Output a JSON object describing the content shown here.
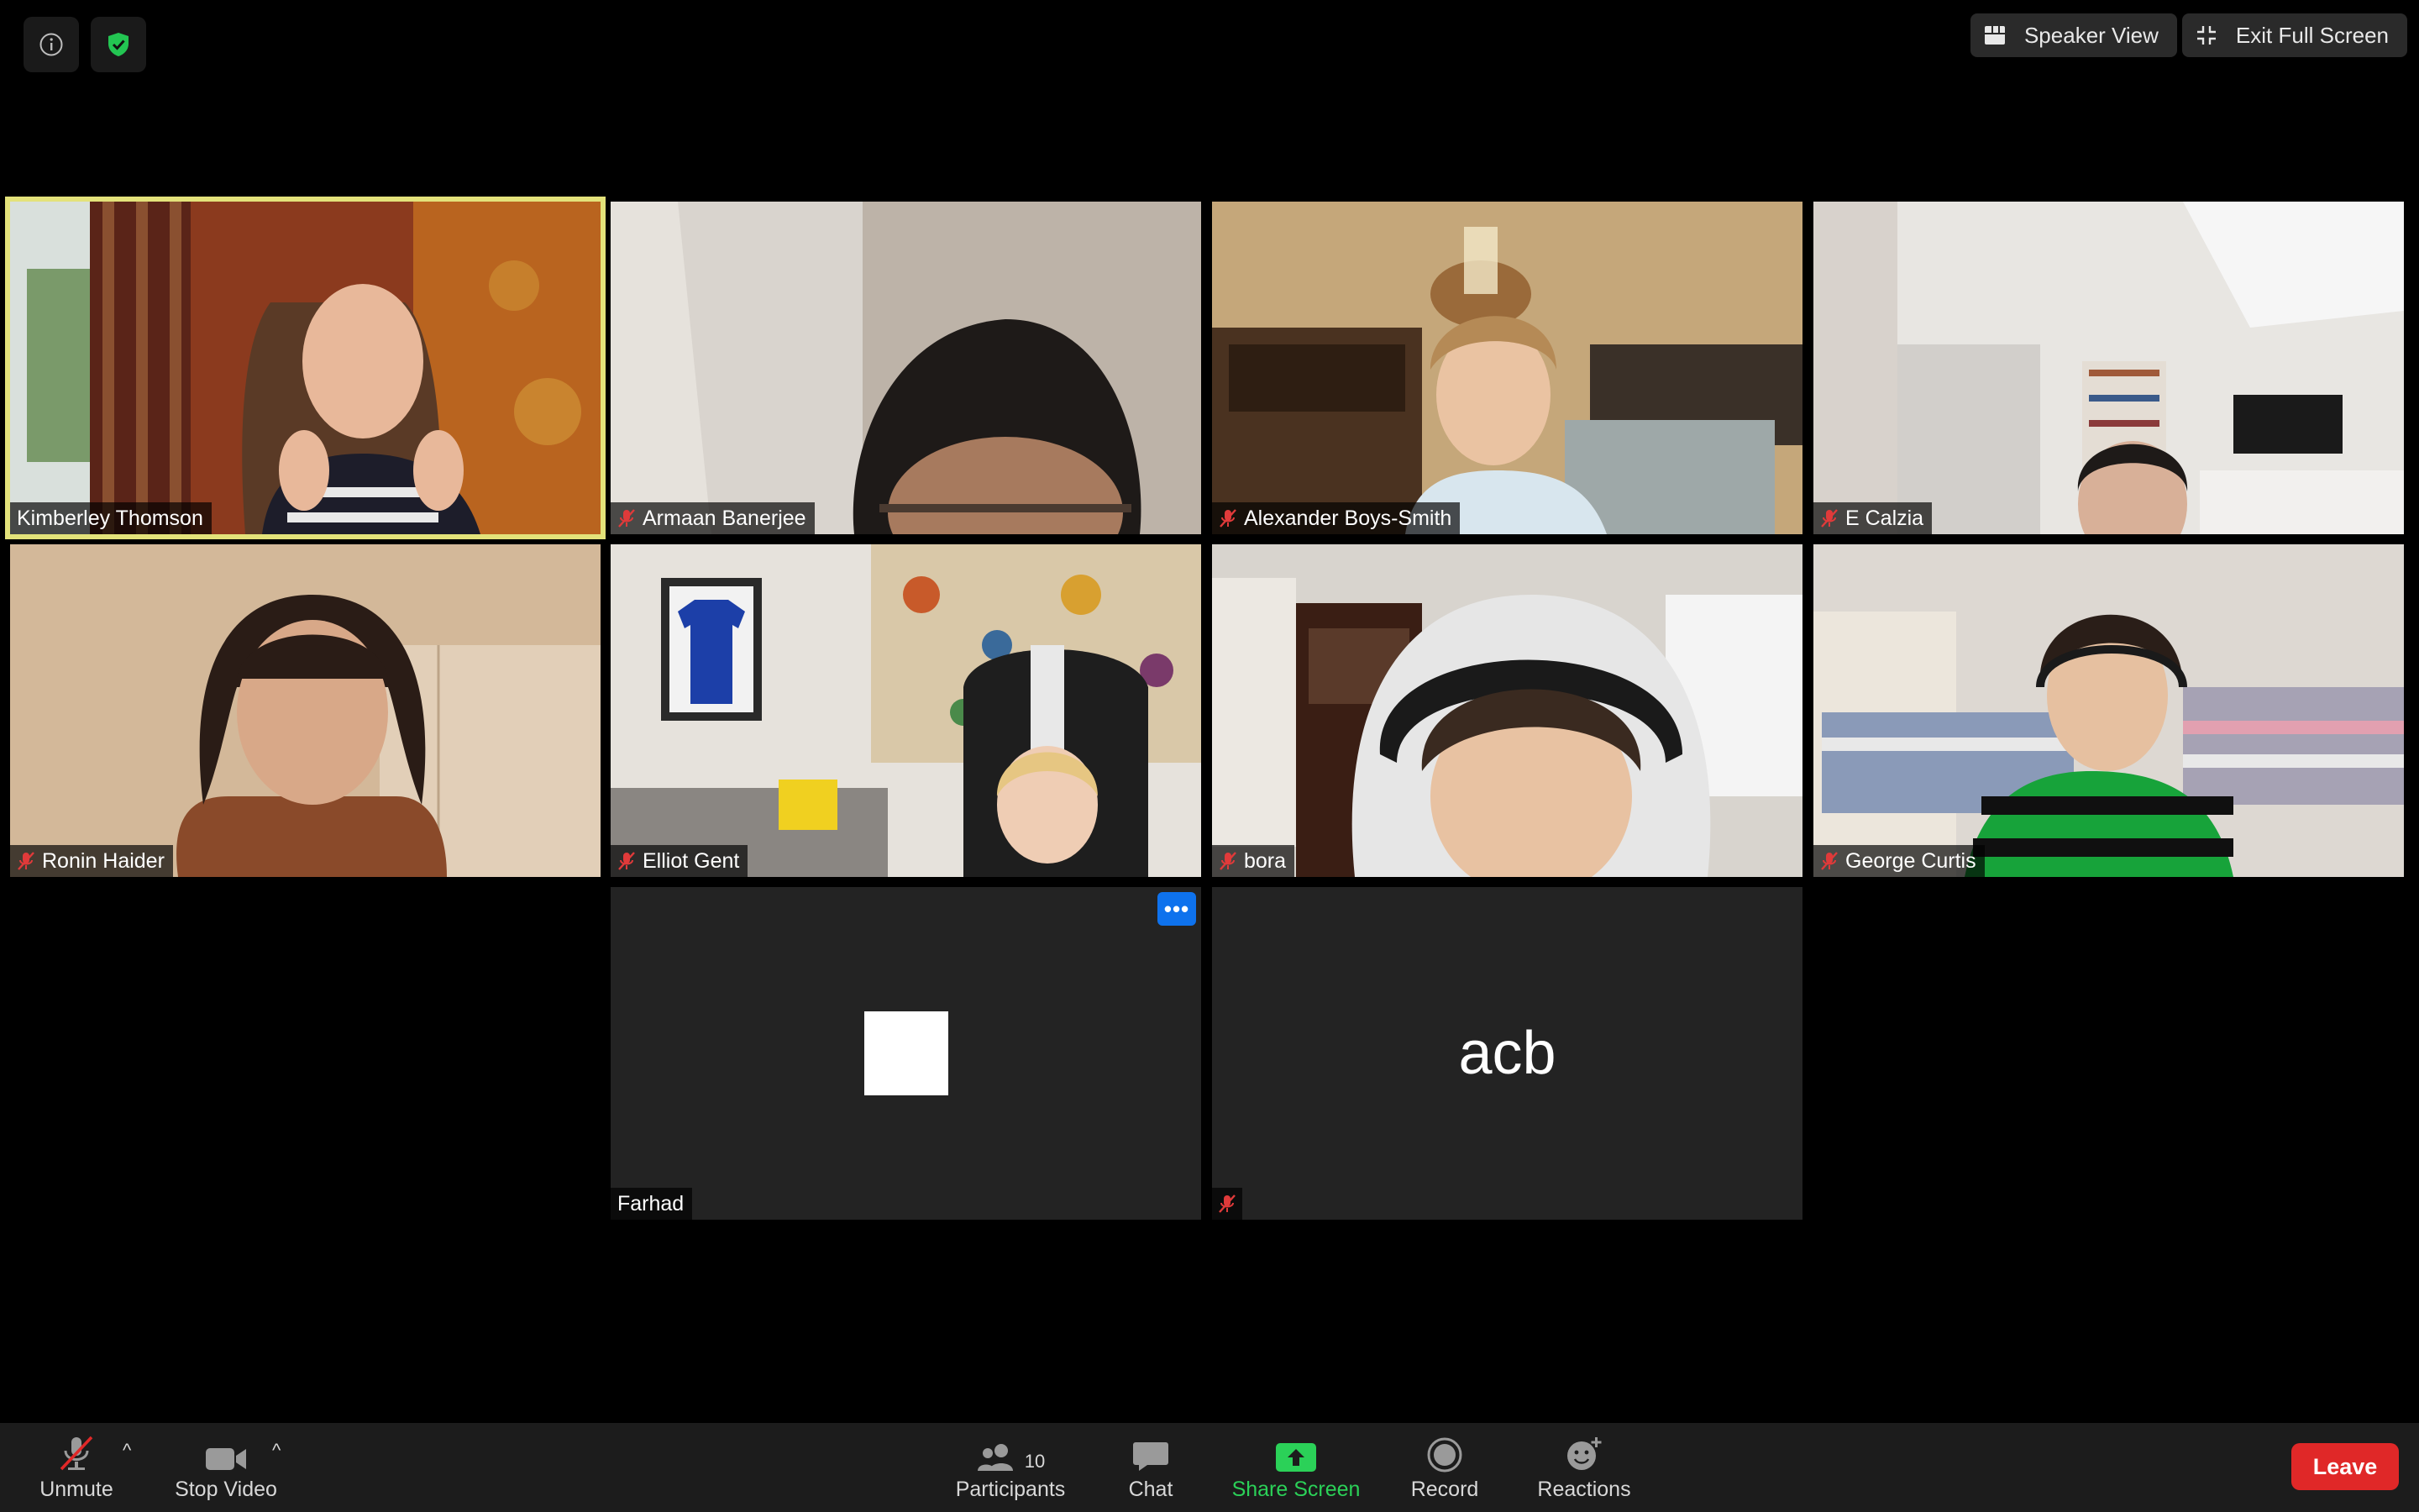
{
  "top_bar": {
    "speaker_view_label": "Speaker View",
    "exit_fullscreen_label": "Exit Full Screen",
    "info_icon": "info-icon",
    "encryption_icon": "shield-check-icon"
  },
  "participants": [
    {
      "name": "Kimberley Thomson",
      "muted": false,
      "active_speaker": true
    },
    {
      "name": "Armaan Banerjee",
      "muted": true
    },
    {
      "name": "Alexander Boys-Smith",
      "muted": true
    },
    {
      "name": "E Calzia",
      "muted": true
    },
    {
      "name": "Ronin Haider",
      "muted": true
    },
    {
      "name": "Elliot Gent",
      "muted": true
    },
    {
      "name": "bora",
      "muted": true
    },
    {
      "name": "George Curtis",
      "muted": true
    },
    {
      "name": "Farhad",
      "muted": false,
      "video": false
    },
    {
      "name": "acb",
      "muted": true,
      "video": false
    }
  ],
  "tiles": {
    "farhad": {
      "name": "Farhad",
      "more_label": "•••"
    },
    "acb": {
      "display": "acb"
    }
  },
  "toolbar": {
    "unmute_label": "Unmute",
    "stop_video_label": "Stop Video",
    "participants_label": "Participants",
    "participants_count": "10",
    "chat_label": "Chat",
    "share_screen_label": "Share Screen",
    "record_label": "Record",
    "reactions_label": "Reactions",
    "leave_label": "Leave",
    "caret": "^"
  },
  "colors": {
    "active_speaker_border": "#e3e27a",
    "share_screen_green": "#2bd158",
    "leave_red": "#e02828",
    "mute_red": "#e03a3a",
    "more_blue": "#0e72ed"
  }
}
